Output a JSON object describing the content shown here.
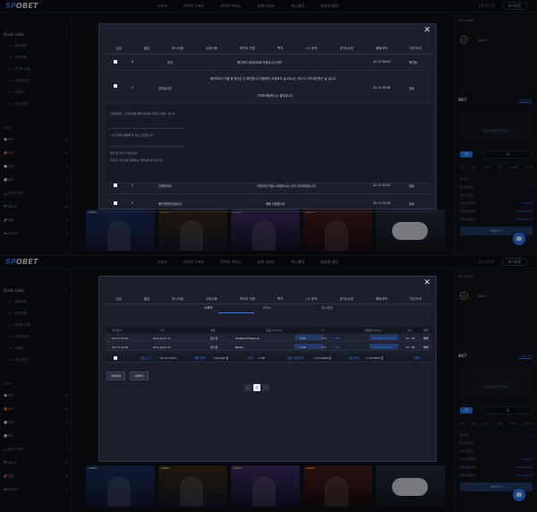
{
  "nav": {
    "logo_prefix": "SP",
    "logo_suffix": "OBET",
    "links": [
      "스포츠",
      "라이브 스포츠",
      "라이브 카지노",
      "슬롯 카지노",
      "미니게임",
      "버츄얼 배팅"
    ],
    "clock_top": "00:13:12",
    "clock_bottom": "00:43:01",
    "login": "로그아웃"
  },
  "sidebar": {
    "heading": "Quick Links",
    "links": [
      "배팅내역",
      "충전신청",
      "포인트 전환",
      "자유게시판",
      "이벤트",
      "공지/규정"
    ],
    "sports_heading": "스포츠",
    "sports": [
      {
        "icon": "⚽",
        "name": "축구",
        "count": "30"
      },
      {
        "icon": "🏀",
        "name": "농구",
        "count": "31"
      },
      {
        "icon": "⚾",
        "name": "야구",
        "count": "8"
      },
      {
        "icon": "🏐",
        "name": "배구",
        "count": "5"
      },
      {
        "icon": "🏒",
        "name": "아이스 하키",
        "count": "1"
      },
      {
        "icon": "🎾",
        "name": "테니스",
        "count": "10"
      },
      {
        "icon": "🏈",
        "name": "풋볼",
        "count": "8"
      },
      {
        "icon": "🎮",
        "name": "E스포츠",
        "count": "9"
      },
      {
        "icon": "⭐",
        "name": "e스포츠",
        "count": "7"
      }
    ]
  },
  "right": {
    "title": "My Profile",
    "user": "user1",
    "bet_heading": "BET",
    "clear": "Clear all",
    "empty_text": "선택된 베팅이 없습니다",
    "single": "단폴",
    "stake": "0",
    "chips": [
      "1만",
      "5만",
      "10만",
      "50만",
      "100만",
      "초기화"
    ],
    "lines": [
      {
        "label": "총 배당",
        "value": "0"
      },
      {
        "label": "총 배팅금액",
        "value": "0"
      },
      {
        "label": "예상 당첨금",
        "value": "0"
      },
      {
        "label": "최소 배팅금액",
        "value": "5,000 원"
      },
      {
        "label": "최대 배팅금액",
        "value": "1,000,000 원"
      },
      {
        "label": "최대 당첨금액",
        "value": "5,000,000 원"
      }
    ],
    "place": "배팅하기"
  },
  "promos": [
    {
      "tag": "1XBET",
      "label": ""
    },
    {
      "tag": "1XBET",
      "label": ""
    },
    {
      "tag": "1XBET",
      "label": ""
    },
    {
      "tag": "1XBET",
      "label": ""
    },
    {
      "tag": "",
      "label": ""
    }
  ],
  "modal_tabs": [
    "입금",
    "출금",
    "머니이동",
    "쿠폰사용",
    "포인트 전환",
    "쪽지",
    "1:1 문의",
    "공지&규정",
    "배팅내역",
    "자신초대"
  ],
  "messages": {
    "headers": [
      "",
      "번호",
      "제목",
      "",
      "날짜",
      "상태"
    ],
    "rows": [
      {
        "no": "6",
        "title": "공지",
        "subject": "레인보우 업데이트에 직접하시는거죠?",
        "date": "02-12 06:52",
        "status": "확인됨"
      },
      {
        "no": "5",
        "title": "공지입니다",
        "subject": "레인보우가 개발 중 정산은 지 확인합니다 매장에서 자동로지 실시하시는 경우 더 지역 확인하는 날 입니다",
        "subject2": "고객에 배팅하시는 결과입니다",
        "date": "02-12 05:40",
        "status": "완료"
      },
      {
        "no": "4",
        "title": "안녕하세요",
        "subject": "지정하여 연습시 매입하시는 분이 공지되었습니다",
        "date": "02-12 05:22",
        "status": "완료"
      },
      {
        "no": "3",
        "title": "충전방법안내입니다",
        "subject": "매충 안정합니다",
        "date": "02-11 23:25",
        "status": "완료"
      }
    ],
    "body": [
      "안녕하세요. 고객센터를 통해 문의를 주세요 (클릭) 합니다.",
      "• 환전계좌 재등록 후 정산 진행입니다.",
      "정산 및 안내 사항입니다.",
      "최고의 서비스를 제공하는 (클릭)에 감사합니다."
    ],
    "body_link": "(클릭)"
  },
  "history": {
    "sub_tabs": [
      "스포츠",
      "카지노",
      "미니게임"
    ],
    "headers": [
      "경기일시",
      "리그",
      "배팅",
      "홈팀 (Home)",
      "무",
      "원정팀 (Away)",
      "점수",
      "결과"
    ],
    "rows": [
      {
        "time": "02-13 02:00",
        "league": "Italy Serie A1",
        "type": "핸디캡",
        "home": "Andjece Phoenics",
        "h_odd": "1.81",
        "draw": "-0.5",
        "a_odd": "1.83",
        "away": "Northern Vikings",
        "score": "79 : 80",
        "result": "패배"
      },
      {
        "time": "02-13 02:00",
        "league": "Italy Serie A1",
        "type": "핸디캡",
        "home": "Nardo",
        "h_odd": "1.81",
        "draw": "7.5",
        "a_odd": "1.83",
        "away": "Latina Basket",
        "score": "79 : 88",
        "result": "패배"
      }
    ],
    "summary": {
      "date_label": "배팅 시간",
      "date": "02-12 00:51",
      "amount_label": "배팅 금액",
      "amount": "520,000 원",
      "odds_label": "배당",
      "odds": "3.38",
      "expect_label": "예상 당첨금액",
      "expect": "1,972,800 원",
      "win_label": "적중 금액",
      "win": "1,972,800 원",
      "status": "패배"
    },
    "buttons": [
      "전체선택",
      "삭제하기"
    ],
    "pages": [
      "‹",
      "1",
      "›"
    ]
  }
}
